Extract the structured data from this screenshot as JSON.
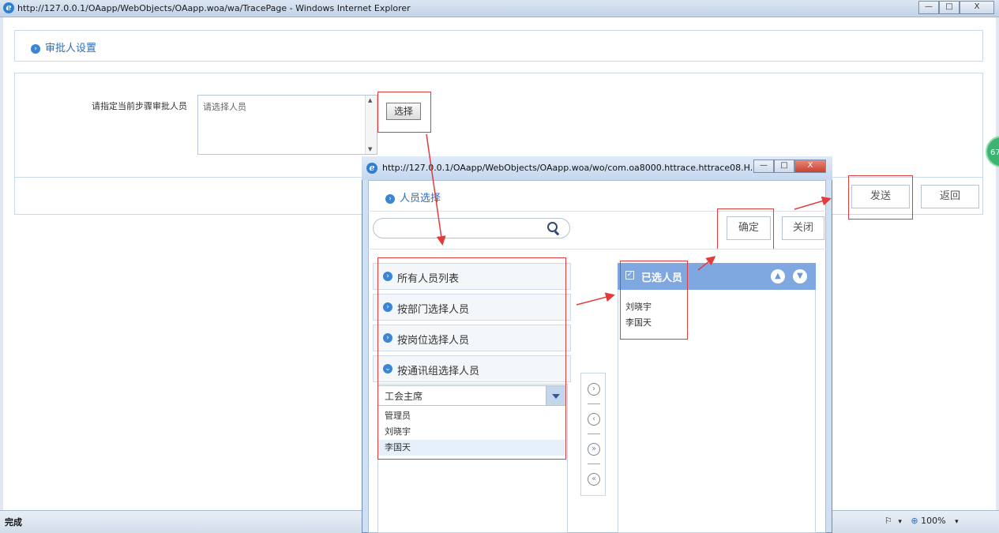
{
  "window": {
    "title": "http://127.0.0.1/OAapp/WebObjects/OAapp.woa/wa/TracePage - Windows Internet Explorer",
    "min_label": "—",
    "max_label": "□",
    "close_label": "X"
  },
  "page": {
    "section_title": "审批人设置",
    "approver_label": "请指定当前步骤审批人员",
    "approver_placeholder": "请选择人员",
    "select_button": "选择",
    "send_button": "发送",
    "back_button": "返回"
  },
  "statusbar": {
    "status": "完成",
    "zoom": "100%",
    "zoom_icon": "⊕",
    "security_icon": "⚐"
  },
  "side_badge": "67",
  "popup": {
    "title": "http://127.0.0.1/OAapp/WebObjects/OAapp.woa/wo/com.oa8000.httrace.httrace08.H...",
    "header": "人员选择",
    "search_placeholder": "",
    "ok_button": "确定",
    "close_button": "关闭",
    "accordion": [
      {
        "label": "所有人员列表",
        "icon": "›"
      },
      {
        "label": "按部门选择人员",
        "icon": "›"
      },
      {
        "label": "按岗位选择人员",
        "icon": "›"
      },
      {
        "label": "按通讯组选择人员",
        "icon": "⌄"
      }
    ],
    "group_select_value": "工会主席",
    "people": [
      "管理员",
      "刘晓宇",
      "李国天"
    ],
    "highlighted_person_index": 2,
    "move_buttons": [
      "›",
      "‹",
      "»",
      "«"
    ],
    "selected_header": "已选人员",
    "selected": [
      "刘晓宇",
      "李国天"
    ]
  },
  "colors": {
    "accent": "#2c6db5",
    "annotation_red": "#e23b3b",
    "selected_header_bg": "#7fa8e0"
  }
}
